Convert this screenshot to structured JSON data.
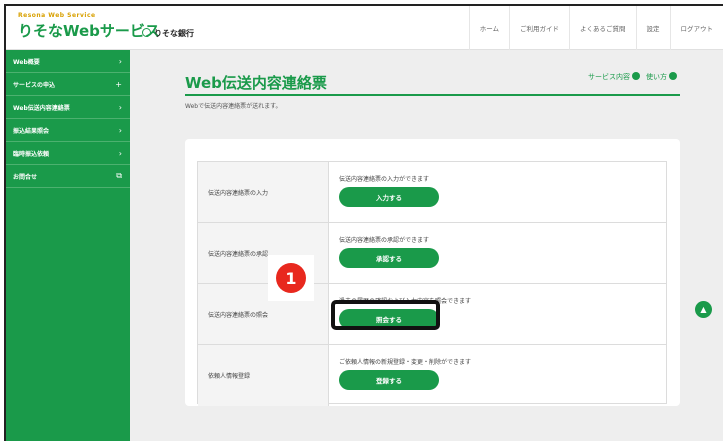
{
  "header": {
    "brand_sub": "Resona Web Service",
    "brand_main": "りそなWebサービス",
    "bank_name": "りそな銀行",
    "nav": [
      "ホーム",
      "ご利用ガイド",
      "よくあるご質問",
      "設定",
      "ログアウト"
    ]
  },
  "sidebar": {
    "items": [
      {
        "label": "Web概要",
        "mark": "›"
      },
      {
        "label": "サービスの申込",
        "mark": "+"
      },
      {
        "label": "Web伝送内容連絡票",
        "mark": "›"
      },
      {
        "label": "振込結果照会",
        "mark": "›"
      },
      {
        "label": "臨時振込依頼",
        "mark": "›"
      },
      {
        "label": "お問合せ",
        "mark": "⧉"
      }
    ]
  },
  "main": {
    "title": "Web伝送内容連絡票",
    "subtitle": "Webで伝送内容連絡票が送れます。",
    "links": [
      "サービス内容",
      "使い方"
    ],
    "rows": [
      {
        "label": "伝送内容連絡票の入力",
        "desc": "伝送内容連絡票の入力ができます",
        "button": "入力する"
      },
      {
        "label": "伝送内容連絡票の承認",
        "desc": "伝送内容連絡票の承認ができます",
        "button": "承認する"
      },
      {
        "label": "伝送内容連絡票の照会",
        "desc": "過去の履歴の確認および入力内容を照会できます",
        "button": "照会する"
      },
      {
        "label": "依頼人情報登録",
        "desc": "ご依頼人情報の新規登録・変更・削除ができます",
        "button": "登録する"
      }
    ]
  },
  "annotation": {
    "step_number": "1"
  },
  "colors": {
    "brand_green": "#1a9a4a",
    "badge_red": "#e8281e",
    "brand_gold": "#d8a000"
  }
}
